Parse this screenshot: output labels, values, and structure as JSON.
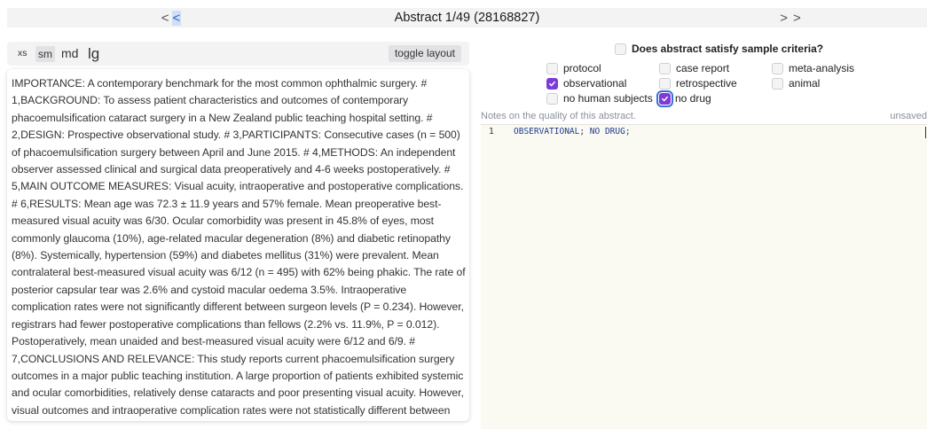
{
  "nav": {
    "prev_first": "<",
    "prev_step": "<",
    "title": "Abstract 1/49 (28168827)",
    "next_step": ">",
    "next_last": ">"
  },
  "toolbar": {
    "sizes": [
      "xs",
      "sm",
      "md",
      "lg"
    ],
    "selected_size": "sm",
    "toggle_label": "toggle layout"
  },
  "abstract": {
    "text": "IMPORTANCE: A contemporary benchmark for the most common ophthalmic surgery. # 1,BACKGROUND: To assess patient characteristics and outcomes of contemporary phacoemulsification cataract surgery in a New Zealand public teaching hospital setting. # 2,DESIGN: Prospective observational study. # 3,PARTICIPANTS: Consecutive cases (n = 500) of phacoemulsification surgery between April and June 2015. # 4,METHODS: An independent observer assessed clinical and surgical data preoperatively and 4-6 weeks postoperatively. # 5,MAIN OUTCOME MEASURES: Visual acuity, intraoperative and postoperative complications. # 6,RESULTS: Mean age was 72.3 ± 11.9 years and 57% female. Mean preoperative best-measured visual acuity was 6/30. Ocular comorbidity was present in 45.8% of eyes, most commonly glaucoma (10%), age-related macular degeneration (8%) and diabetic retinopathy (8%). Systemically, hypertension (59%) and diabetes mellitus (31%) were prevalent. Mean contralateral best-measured visual acuity was 6/12 (n = 495) with 62% being phakic. The rate of posterior capsular tear was 2.6% and cystoid macular oedema 3.5%. Intraoperative complication rates were not significantly different between surgeon levels (P = 0.234). However, registrars had fewer postoperative complications than fellows (2.2% vs. 11.9%, P = 0.012). Postoperatively, mean unaided and best-measured visual acuity were 6/12 and 6/9. # 7,CONCLUSIONS AND RELEVANCE: This study reports current phacoemulsification surgery outcomes in a major public teaching institution. A large proportion of patients exhibited systemic and ocular comorbidities, relatively dense cataracts and poor presenting visual acuity. However, visual outcomes and intraoperative complication rates were not statistically different between trainees and senior"
  },
  "criteria": {
    "question": "Does abstract satisfy sample criteria?",
    "checked": false
  },
  "options": [
    {
      "label": "protocol",
      "checked": false
    },
    {
      "label": "case report",
      "checked": false
    },
    {
      "label": "meta-analysis",
      "checked": false
    },
    {
      "label": "observational",
      "checked": true
    },
    {
      "label": "retrospective",
      "checked": false
    },
    {
      "label": "animal",
      "checked": false
    },
    {
      "label": "no human subjects",
      "checked": false
    },
    {
      "label": "no drug",
      "checked": true
    }
  ],
  "notes": {
    "placeholder": "Notes on the quality of this abstract.",
    "status": "unsaved",
    "line_number": "1",
    "content": "OBSERVATIONAL; NO DRUG;"
  },
  "colors": {
    "checkbox_checked": "#7c3ad8",
    "focus_ring": "#3b6fd6",
    "editor_bg": "#fafaf3"
  }
}
